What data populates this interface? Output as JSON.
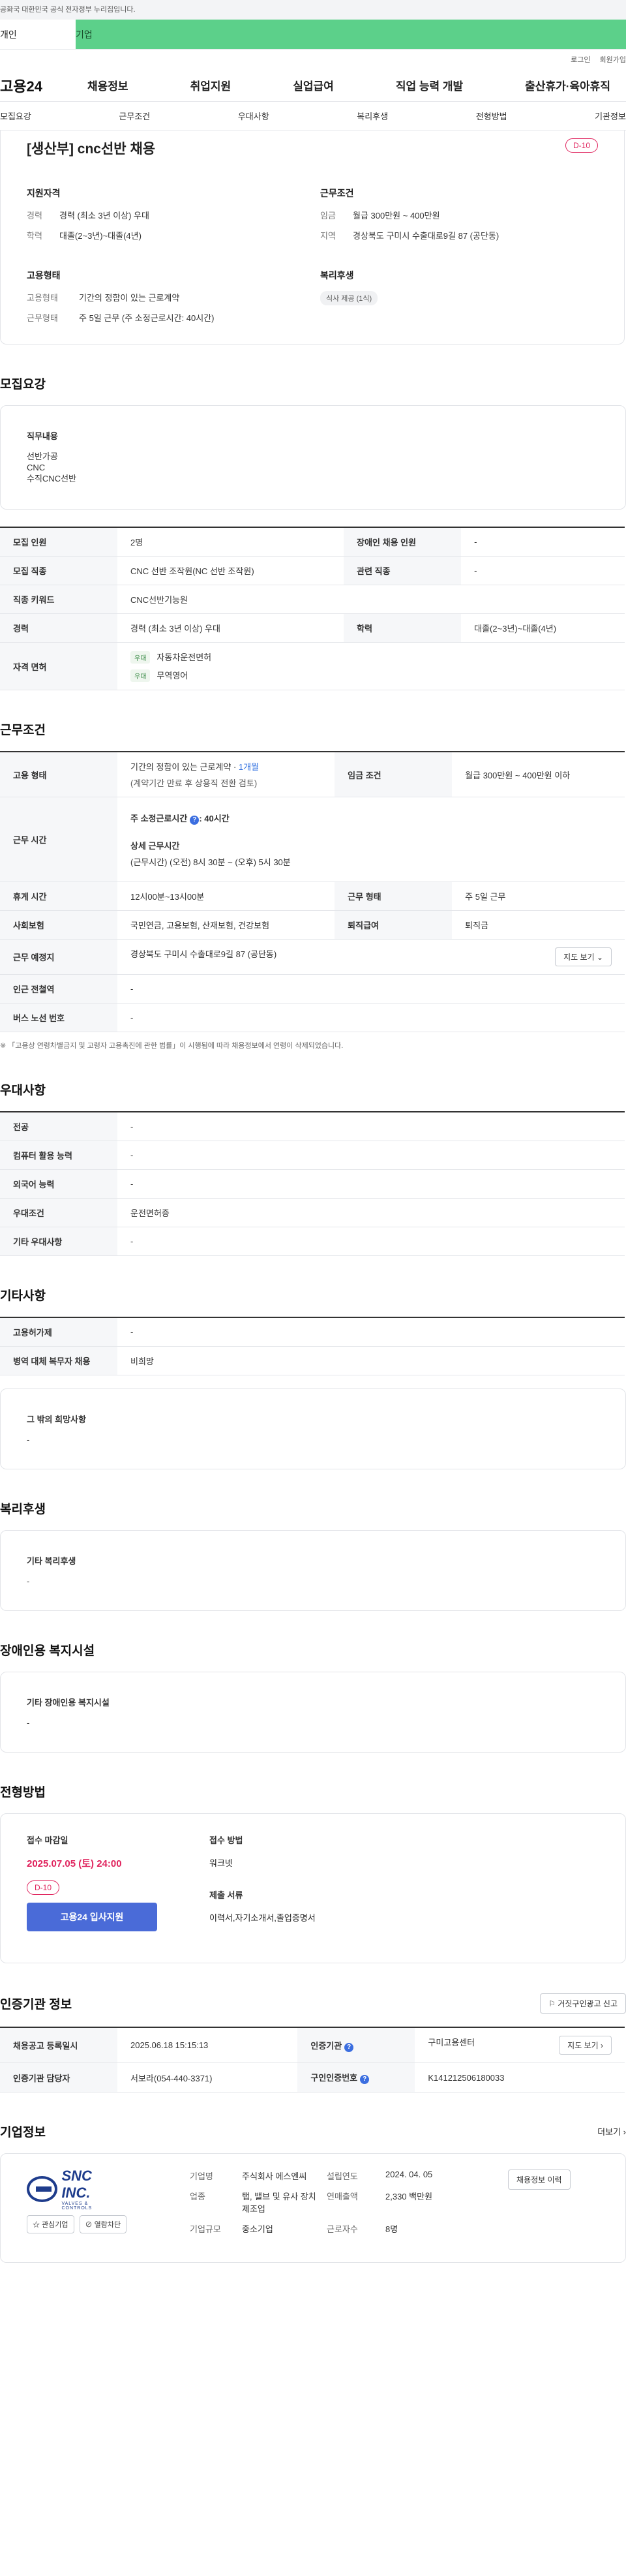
{
  "gov_banner": "공화국 대한민국 공식 전자정부 누리집입니다.",
  "top_tabs": [
    "개인",
    "기업"
  ],
  "util_links": [
    "로그인",
    "회원가입"
  ],
  "logo": "고용24",
  "gnb": [
    "채용정보",
    "취업지원",
    "실업급여",
    "직업 능력 개발",
    "출산휴가·육아휴직"
  ],
  "subtabs": [
    "모집요강",
    "근무조건",
    "우대사항",
    "복리후생",
    "전형방법",
    "기관정보"
  ],
  "summary": {
    "title": "[생산부] cnc선반 채용",
    "dday": "D-10",
    "qual_title": "지원자격",
    "qual": [
      {
        "k": "경력",
        "v": "경력 (최소 3년 이상) 우대"
      },
      {
        "k": "학력",
        "v": "대졸(2~3년)~대졸(4년)"
      }
    ],
    "cond_title": "근무조건",
    "cond": [
      {
        "k": "임금",
        "v": "월급 300만원 ~ 400만원"
      },
      {
        "k": "지역",
        "v": "경상북도 구미시 수출대로9길 87 (공단동)"
      }
    ],
    "emp_title": "고용형태",
    "emp": [
      {
        "k": "고용형태",
        "v": "기간의 정함이 있는 근로계약"
      },
      {
        "k": "근무형태",
        "v": "주 5일 근무 (주 소정근로시간: 40시간)"
      }
    ],
    "welfare_title": "복리후생",
    "welfare_pill": "식사 제공 (1식)"
  },
  "recruit": {
    "section": "모집요강",
    "job_title": "직무내용",
    "job_lines": [
      "선반가공",
      "CNC",
      "수직CNC선반"
    ],
    "rows": {
      "count_k": "모집 인원",
      "count_v": "2명",
      "disabled_k": "장애인 채용 인원",
      "disabled_v": "-",
      "job_k": "모집 직종",
      "job_v": "CNC 선반 조작원(NC 선반 조작원)",
      "related_k": "관련 직종",
      "related_v": "-",
      "kw_k": "직종 키워드",
      "kw_v": "CNC선반기능원",
      "career_k": "경력",
      "career_v": "경력 (최소 3년 이상) 우대",
      "edu_k": "학력",
      "edu_v": "대졸(2~3년)~대졸(4년)",
      "license_k": "자격 면허",
      "license_badge": "우대",
      "license_items": [
        "자동차운전면허",
        "무역영어"
      ]
    }
  },
  "work": {
    "section": "근무조건",
    "emp_k": "고용 형태",
    "emp_v1": "기간의 정함이 있는 근로계약 · ",
    "emp_v1_blue": "1개월",
    "emp_v2": "(계약기간 만료 후 상용직 전환 검토)",
    "wage_k": "임금 조건",
    "wage_v": "월급 300만원 ~ 400만원 이하",
    "hours_k": "근무 시간",
    "hours_label": "주 소정근로시간",
    "hours_value": ": 40시간",
    "hours_detail_title": "상세 근무시간",
    "hours_detail": "(근무시간) (오전) 8시 30분 ~ (오후) 5시 30분",
    "break_k": "휴게 시간",
    "break_v": "12시00분~13시00분",
    "form_k": "근무 형태",
    "form_v": "주 5일 근무",
    "ins_k": "사회보험",
    "ins_v": "국민연금, 고용보험, 산재보험, 건강보험",
    "retire_k": "퇴직급여",
    "retire_v": "퇴직금",
    "place_k": "근무 예정지",
    "place_v": "경상북도 구미시 수출대로9길 87 (공단동)",
    "map_btn": "지도 보기",
    "subway_k": "인근 전철역",
    "subway_v": "-",
    "bus_k": "버스 노선 번호",
    "bus_v": "-",
    "note": "※ 「고용상 연령차별금지 및 고령자 고용촉진에 관한 법률」이 시행됨에 따라 채용정보에서 연령이 삭제되었습니다."
  },
  "pref": {
    "section": "우대사항",
    "rows": [
      {
        "k": "전공",
        "v": "-"
      },
      {
        "k": "컴퓨터 활용 능력",
        "v": "-"
      },
      {
        "k": "외국어 능력",
        "v": "-"
      },
      {
        "k": "우대조건",
        "v": "운전면허증"
      },
      {
        "k": "기타 우대사항",
        "v": "-"
      }
    ]
  },
  "etc": {
    "section": "기타사항",
    "rows": [
      {
        "k": "고용허가제",
        "v": "-"
      },
      {
        "k": "병역 대체 복무자 채용",
        "v": "비희망"
      }
    ],
    "other_title": "그 밖의 희망사항",
    "other_v": "-"
  },
  "welfare": {
    "section": "복리후생",
    "title": "기타 복리후생",
    "v": "-"
  },
  "disability": {
    "section": "장애인용 복지시설",
    "title": "기타 장애인용 복지시설",
    "v": "-"
  },
  "apply": {
    "section": "전형방법",
    "deadline_title": "접수 마감일",
    "deadline": "2025.07.05 (토) 24:00",
    "dday": "D-10",
    "apply_btn": "고용24 입사지원",
    "method_title": "접수 방법",
    "method_v": "워크넷",
    "docs_title": "제출 서류",
    "docs_v": "이력서,자기소개서,졸업증명서"
  },
  "agency": {
    "section": "인증기관 정보",
    "report_btn": "거짓구인광고 신고",
    "reg_k": "채용공고 등록일시",
    "reg_v": "2025.06.18 15:15:13",
    "org_k": "인증기관",
    "org_v": "구미고용센터",
    "map_btn": "지도 보기",
    "mgr_k": "인증기관 담당자",
    "mgr_v": "서보라(054-440-3371)",
    "reqno_k": "구인인증번호",
    "reqno_v": "K141212506180033"
  },
  "company": {
    "section": "기업정보",
    "more": "더보기",
    "logo_text": "SNC INC.",
    "logo_sub": "VALVES & CONTROLS",
    "fav_btn": "관심기업",
    "block_btn": "열람차단",
    "name_k": "기업명",
    "name_v": "주식회사 에스엔씨",
    "founded_k": "설립연도",
    "founded_v": "2024. 04. 05",
    "biz_k": "업종",
    "biz_v": "탭, 밸브 및 유사 장치 제조업",
    "sales_k": "연매출액",
    "sales_v": "2,330 백만원",
    "size_k": "기업규모",
    "size_v": "중소기업",
    "emp_k": "근로자수",
    "emp_v": "8명",
    "detail_btn": "채용정보 이력"
  }
}
